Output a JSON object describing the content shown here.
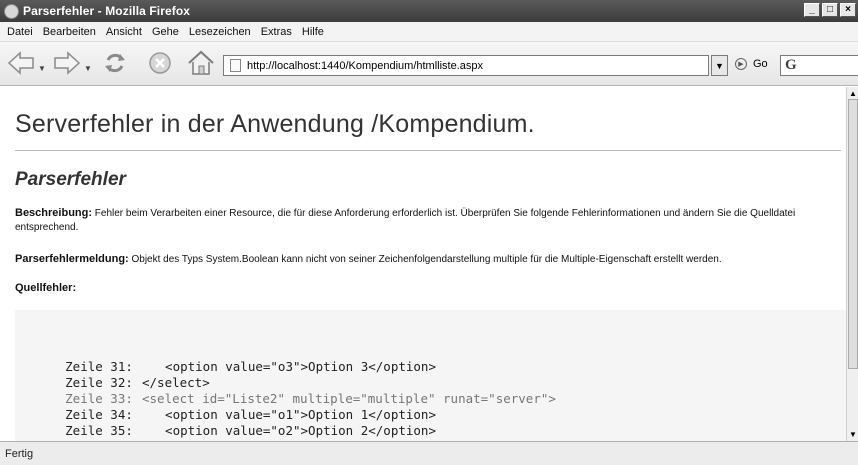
{
  "window": {
    "title": "Parserfehler - Mozilla Firefox",
    "buttons": [
      "_",
      "□",
      "×"
    ]
  },
  "menu": [
    "Datei",
    "Bearbeiten",
    "Ansicht",
    "Gehe",
    "Lesezeichen",
    "Extras",
    "Hilfe"
  ],
  "toolbar": {
    "url": "http://localhost:1440/Kompendium/htmlliste.aspx",
    "go_label": "Go",
    "search_icon": "G"
  },
  "page": {
    "title": "Serverfehler in der Anwendung /Kompendium.",
    "subtitle": "Parserfehler",
    "description_label": "Beschreibung:",
    "description_text": " Fehler beim Verarbeiten einer Resource, die für diese Anforderung erforderlich ist. Überprüfen Sie folgende Fehlerinformationen und ändern Sie die Quelldatei entsprechend.",
    "message_label": "Parserfehlermeldung:",
    "message_text": " Objekt des Typs System.Boolean kann nicht von seiner Zeichenfolgendarstellung multiple für die Multiple-Eigenschaft erstellt werden.",
    "source_label": "Quellfehler:",
    "code_lines": [
      {
        "line": "Zeile 31:",
        "code": "  <option value=\"o3\">Option 3</option>"
      },
      {
        "line": "Zeile 32:",
        "code": "</select>"
      },
      {
        "line": "Zeile 33:",
        "code": "<select id=\"Liste2\" multiple=\"multiple\" runat=\"server\">"
      },
      {
        "line": "Zeile 34:",
        "code": "  <option value=\"o1\">Option 1</option>"
      },
      {
        "line": "Zeile 35:",
        "code": "  <option value=\"o2\">Option 2</option>"
      }
    ]
  },
  "status": {
    "text": "Fertig"
  }
}
